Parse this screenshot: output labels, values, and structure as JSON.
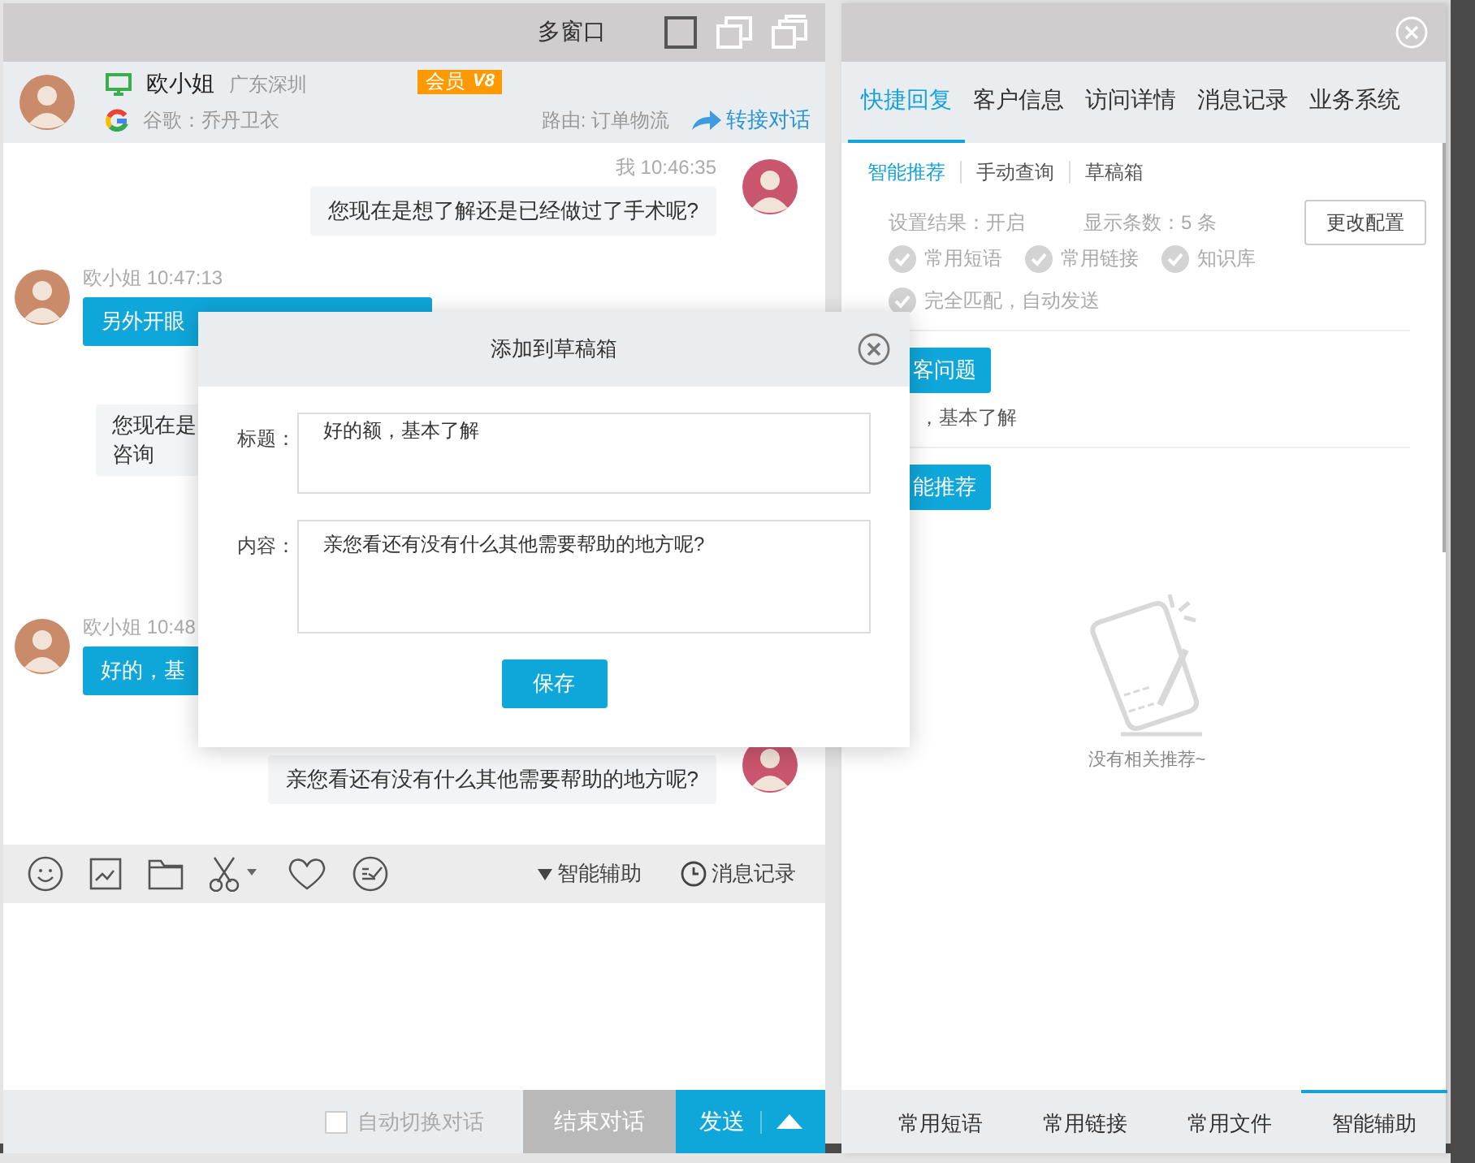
{
  "main_window": {
    "title": "多窗口"
  },
  "customer": {
    "name": "欧小姐",
    "location": "广东深圳",
    "source": "谷歌：乔丹卫衣",
    "member_label": "会员",
    "vip_level": "V8",
    "route": "路由: 订单物流",
    "transfer": "转接对话"
  },
  "messages": [
    {
      "kind": "agent",
      "meta": "我 10:46:35",
      "text": "您现在是想了解还是已经做过了手术呢?"
    },
    {
      "kind": "customer",
      "meta": "欧小姐 10:47:13",
      "text": "另外开眼"
    },
    {
      "kind": "quote",
      "lines": [
        "您现在是",
        "咨询"
      ]
    },
    {
      "kind": "customer",
      "meta": "欧小姐 10:48",
      "text": "好的，基"
    },
    {
      "kind": "agent",
      "text": "亲您看还有没有什么其他需要帮助的地方呢?"
    }
  ],
  "toolbar": {
    "assist": "智能辅助",
    "history": "消息记录"
  },
  "composer": {
    "auto_switch": {
      "label": "自动切换对话",
      "checked": false
    },
    "end_button": "结束对话",
    "send_button": "发送"
  },
  "side_panel": {
    "tabs": [
      {
        "label": "快捷回复",
        "selected": true
      },
      {
        "label": "客户信息",
        "selected": false
      },
      {
        "label": "访问详情",
        "selected": false
      },
      {
        "label": "消息记录",
        "selected": false
      },
      {
        "label": "业务系统",
        "selected": false
      }
    ],
    "subtabs": [
      {
        "label": "智能推荐",
        "selected": true
      },
      {
        "label": "手动查询",
        "selected": false
      },
      {
        "label": "草稿箱",
        "selected": false
      }
    ],
    "settings": {
      "result": "设置结果：开启",
      "count": "显示条数：5  条",
      "button": "更改配置"
    },
    "options": [
      {
        "label": "常用短语",
        "checked": true
      },
      {
        "label": "常用链接",
        "checked": true
      },
      {
        "label": "知识库",
        "checked": true
      },
      {
        "label": "完全匹配，自动发送",
        "checked": true
      }
    ],
    "suggestions": [
      {
        "kind": "tag",
        "text": "客问题"
      },
      {
        "kind": "text",
        "text": "，基本了解"
      },
      {
        "kind": "tag",
        "text": "能推荐"
      }
    ],
    "empty_text": "没有相关推荐~",
    "bottom_tabs": [
      {
        "label": "常用短语",
        "selected": false
      },
      {
        "label": "常用链接",
        "selected": false
      },
      {
        "label": "常用文件",
        "selected": false
      },
      {
        "label": "智能辅助",
        "selected": true
      }
    ]
  },
  "dialog": {
    "title": "添加到草稿箱",
    "fields": [
      {
        "kind": "input",
        "label": "标题：",
        "value": "好的额，基本了解"
      },
      {
        "kind": "textarea",
        "label": "内容：",
        "value": "亲您看还有没有什么其他需要帮助的地方呢?"
      }
    ],
    "save_button": "保存"
  }
}
